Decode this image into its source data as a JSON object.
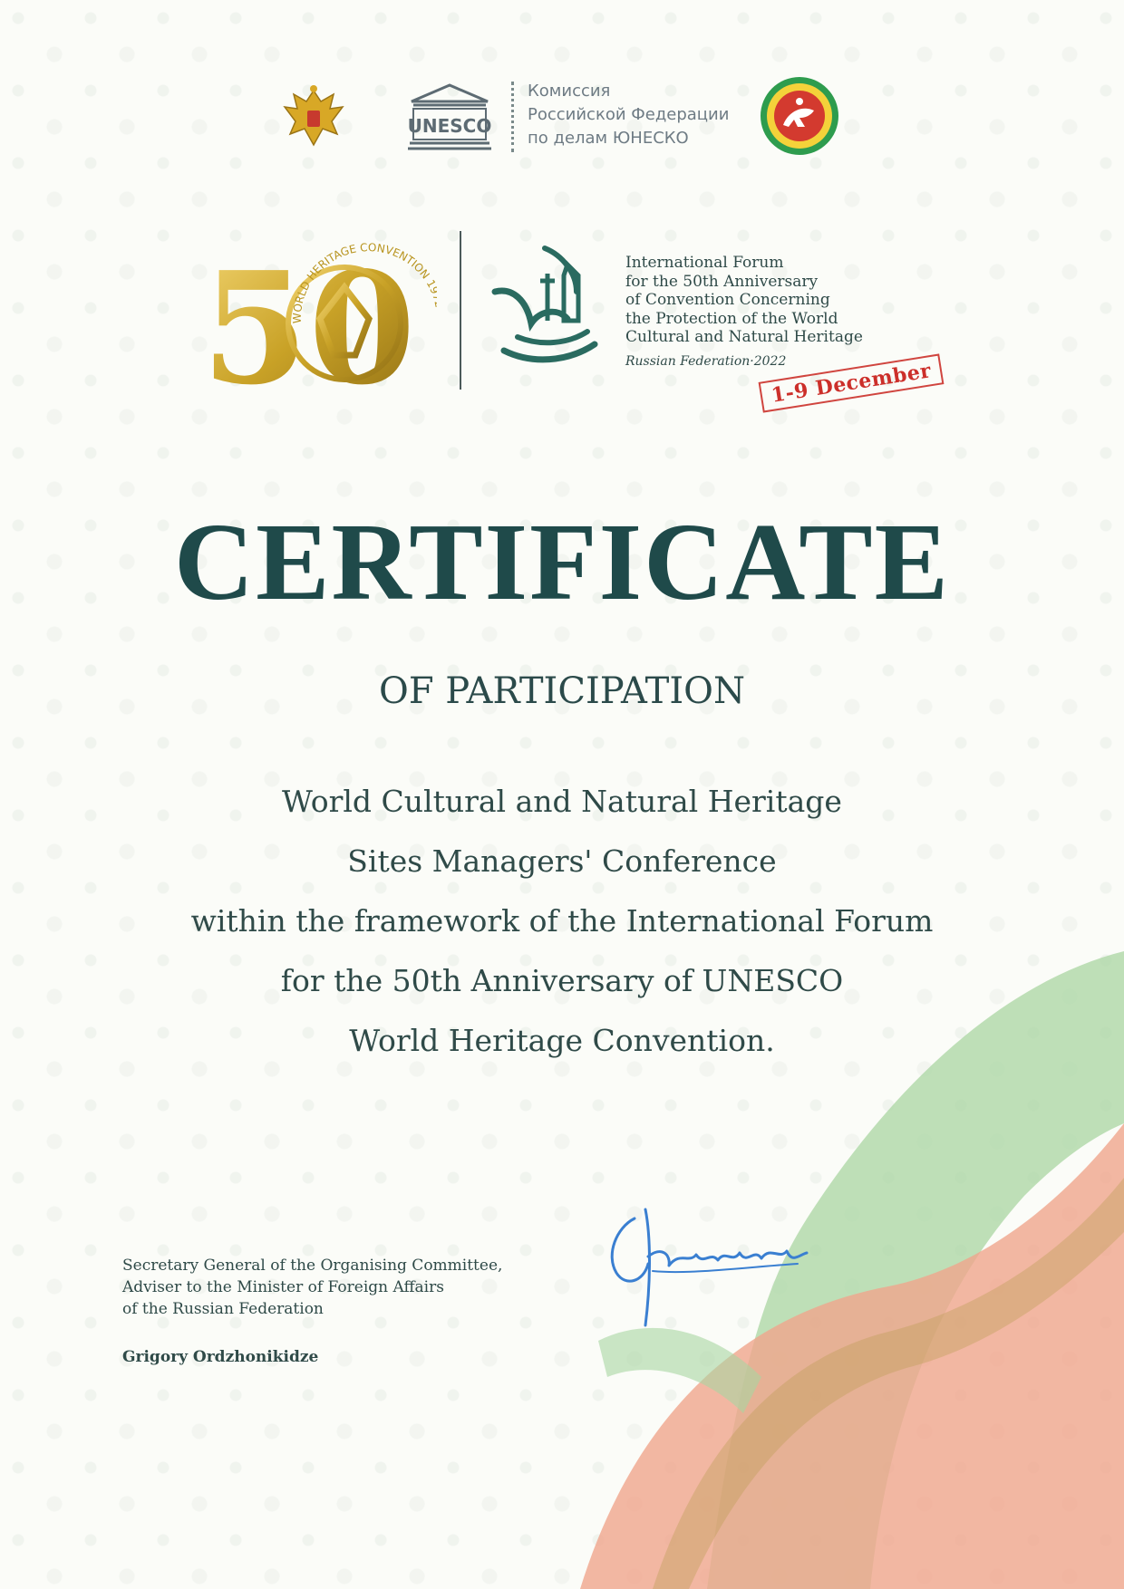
{
  "header": {
    "commission_lines": [
      "Комиссия",
      "Российской Федерации",
      "по делам ЮНЕСКО"
    ],
    "unesco_logo_text": "UNESCO",
    "whc_logo": {
      "number": "50",
      "ring_text": "WORLD HERITAGE CONVENTION 1972"
    }
  },
  "forum": {
    "title_lines": [
      "International Forum",
      "for the 50th Anniversary",
      "of Convention Concerning",
      "the Protection of the World",
      "Cultural and Natural Heritage"
    ],
    "place": "Russian Federation·2022",
    "dates": "1-9 December"
  },
  "certificate": {
    "title": "CERTIFICATE",
    "subtitle": "OF PARTICIPATION",
    "body_lines": [
      "World Cultural and Natural Heritage",
      "Sites Managers' Conference",
      "within the framework of the International Forum",
      "for the 50th Anniversary of UNESCO",
      "World Heritage Convention."
    ]
  },
  "signatory": {
    "title_lines": [
      "Secretary General of the Organising Committee,",
      "Adviser to the Minister of Foreign Affairs",
      "of the Russian Federation"
    ],
    "name": "Grigory Ordzhonikidze"
  },
  "colors": {
    "title": "#1f4a4a",
    "text": "#2f4a48",
    "gold": "#c9a227",
    "stamp_red": "#cc2f2a",
    "green_wave": "#a9d5a2",
    "salmon_wave": "#f0a58c",
    "signature_blue": "#3a7fd1"
  }
}
